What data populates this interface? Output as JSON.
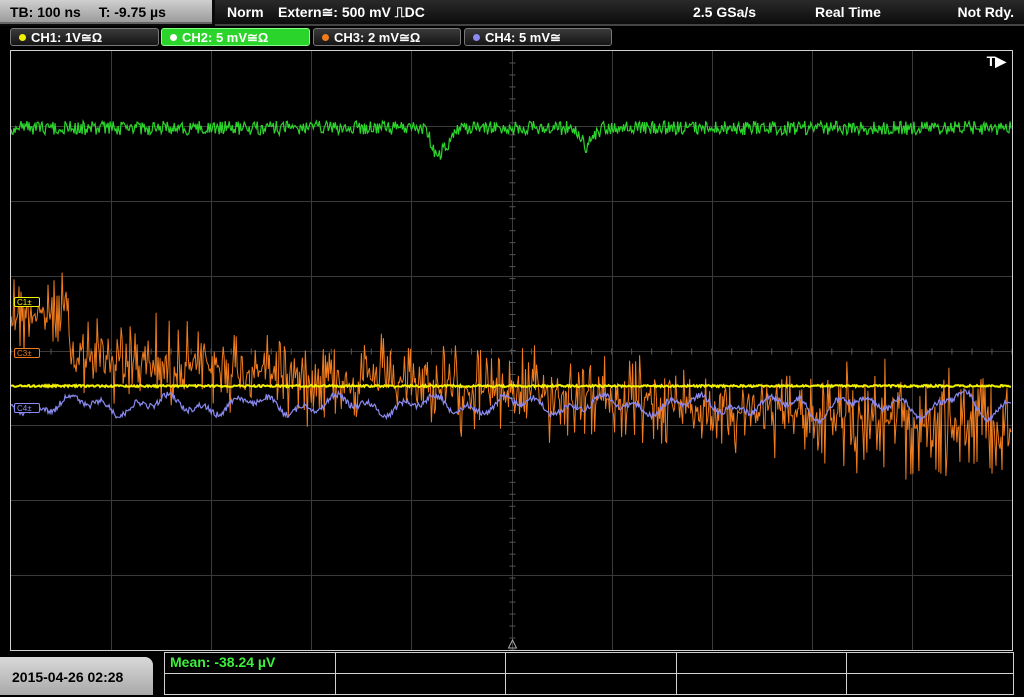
{
  "status": {
    "timebase": "TB: 100 ns",
    "trigger_time": "T: -9.75 µs",
    "mode": "Norm",
    "trigger": "Extern≅: 500 mV ⎍DC",
    "sample_rate": "2.5 GSa/s",
    "acq_mode": "Real Time",
    "state": "Not Rdy."
  },
  "channels": [
    {
      "label": "CH1: 1V≅Ω",
      "color": "#f2f200",
      "active": false
    },
    {
      "label": "CH2: 5 mV≅Ω",
      "color": "#2bd42b",
      "active": true
    },
    {
      "label": "CH3: 2 mV≅Ω",
      "color": "#f07c1e",
      "active": false
    },
    {
      "label": "CH4: 5 mV≅",
      "color": "#8a8af2",
      "active": false
    }
  ],
  "ref_markers": {
    "c1": "C1±",
    "c3": "C3±",
    "c4": "C4±"
  },
  "trigger_marker": "T▶",
  "datetime": "2015-04-26 02:28",
  "measurement": {
    "mean": "Mean: -38.24 µV"
  },
  "colors": {
    "ch1": "#f2f200",
    "ch2": "#2bd42b",
    "ch3": "#f07c1e",
    "ch4": "#8a8af2",
    "grid": "#3a3a3a"
  }
}
